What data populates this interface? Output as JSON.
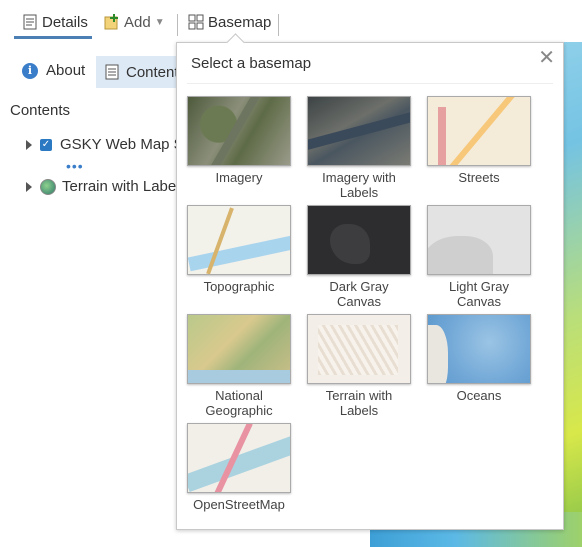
{
  "toolbar": {
    "details_label": "Details",
    "add_label": "Add",
    "basemap_label": "Basemap"
  },
  "panel": {
    "about_tab": "About",
    "content_tab": "Content",
    "contents_heading": "Contents",
    "layers": [
      {
        "label": "GSKY Web Map Se",
        "checked": true
      },
      {
        "label": "Terrain with Labels"
      }
    ],
    "more_dots": "•••"
  },
  "basemap_popover": {
    "title": "Select a basemap",
    "close_glyph": "✕",
    "options": [
      {
        "label": "Imagery"
      },
      {
        "label": "Imagery with Labels"
      },
      {
        "label": "Streets"
      },
      {
        "label": "Topographic"
      },
      {
        "label": "Dark Gray Canvas"
      },
      {
        "label": "Light Gray Canvas"
      },
      {
        "label": "National Geographic"
      },
      {
        "label": "Terrain with Labels"
      },
      {
        "label": "Oceans"
      },
      {
        "label": "OpenStreetMap"
      }
    ]
  },
  "colors": {
    "accent": "#4c7fb4",
    "tab_active_bg": "#dde9f5"
  }
}
